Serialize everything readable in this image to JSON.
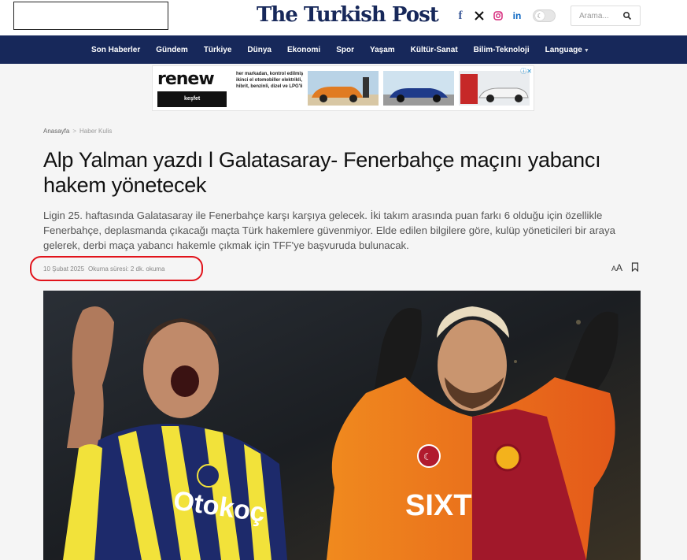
{
  "header": {
    "logo_text": "The Turkish Post",
    "socials": [
      {
        "icon": "facebook-icon",
        "glyph": "f"
      },
      {
        "icon": "x-icon",
        "glyph": "𝕏"
      },
      {
        "icon": "instagram-icon",
        "glyph": "◎"
      },
      {
        "icon": "linkedin-icon",
        "glyph": "in"
      }
    ],
    "search_placeholder": "Arama..."
  },
  "nav": {
    "items": [
      "Son Haberler",
      "Gündem",
      "Türkiye",
      "Dünya",
      "Ekonomi",
      "Spor",
      "Yaşam",
      "Kültür-Sanat",
      "Bilim-Teknoloji",
      "Language"
    ]
  },
  "ad": {
    "logo": "renew",
    "button": "keşfet",
    "text": "her markadan, kontrol edilmiş ikinci el otomobiller elektrikli, hibrit, benzinli, dizel ve LPG'li"
  },
  "breadcrumb": {
    "home": "Anasayfa",
    "separator": ">",
    "current": "Haber Kulis"
  },
  "article": {
    "title": "Alp Yalman yazdı l Galatasaray- Fenerbahçe maçını yabancı hakem yönetecek",
    "summary": "Ligin 25. haftasında Galatasaray ile Fenerbahçe karşı karşıya gelecek. İki takım arasında puan farkı 6 olduğu için özellikle Fenerbahçe, deplasmanda çıkacağı maçta Türk hakemlere güvenmiyor. Elde edilen bilgilere göre, kulüp yöneticileri bir araya gelerek, derbi maça yabancı hakemle çıkmak için TFF'ye başvuruda bulunacak.",
    "date": "10 Şubat 2025",
    "reading_time": "Okuma süresi: 2 dk. okuma",
    "font_toggle_label": "AA"
  },
  "hero": {
    "left_jersey_text": "Otokoç",
    "right_jersey_text": "SIXT"
  },
  "colors": {
    "brand_navy": "#17285a",
    "highlight_red": "#e1131b"
  }
}
